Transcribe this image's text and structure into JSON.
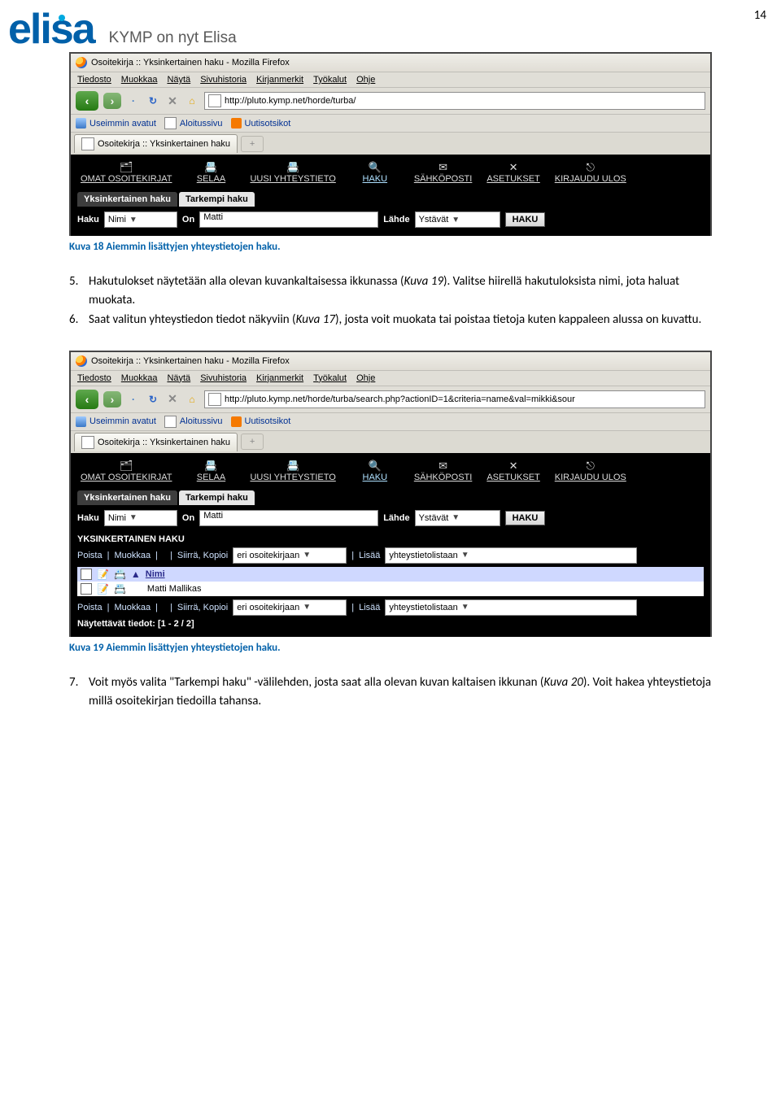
{
  "page_number": "14",
  "logo_text": "elisa",
  "logo_sub": "KYMP on nyt Elisa",
  "shot1": {
    "title": "Osoitekirja :: Yksinkertainen haku - Mozilla Firefox",
    "menu": {
      "t": "Tiedosto",
      "m": "Muokkaa",
      "n": "Näytä",
      "s": "Sivuhistoria",
      "k": "Kirjanmerkit",
      "ty": "Työkalut",
      "o": "Ohje"
    },
    "url": "http://pluto.kymp.net/horde/turba/",
    "bm": {
      "a": "Useimmin avatut",
      "b": "Aloitussivu",
      "c": "Uutisotsikot"
    },
    "tab": "Osoitekirja :: Yksinkertainen haku",
    "topmenu": {
      "omat": "OMAT OSOITEKIRJAT",
      "selaa": "SELAA",
      "uusi": "UUSI YHTEYSTIETO",
      "haku": "HAKU",
      "sahko": "SÄHKÖPOSTI",
      "aset": "ASETUKSET",
      "kirj": "KIRJAUDU ULOS"
    },
    "subtabs": {
      "a": "Yksinkertainen haku",
      "b": "Tarkempi haku"
    },
    "labels": {
      "haku": "Haku",
      "on": "On",
      "lahde": "Lähde",
      "btn": "HAKU"
    },
    "field": "Nimi",
    "value": "Matti",
    "source": "Ystävät"
  },
  "cap1": "Kuva 18 Aiemmin lisättyjen yhteystietojen haku.",
  "para_5": {
    "n": "5.",
    "a": "Hakutulokset näytetään alla olevan kuvankaltaisessa ikkunassa (",
    "i": "Kuva 19",
    "b": "). Valitse hiirellä hakutuloksista nimi, jota haluat muokata."
  },
  "para_6": {
    "n": "6.",
    "a": "Saat valitun yhteystiedon tiedot näkyviin (",
    "i": "Kuva 17",
    "b": "), josta voit muokata tai poistaa tietoja kuten kappaleen alussa on kuvattu."
  },
  "shot2": {
    "title": "Osoitekirja :: Yksinkertainen haku - Mozilla Firefox",
    "url": "http://pluto.kymp.net/horde/turba/search.php?actionID=1&criteria=name&val=mikki&sour",
    "reshdr": "YKSINKERTAINEN HAKU",
    "tb": {
      "poista": "Poista",
      "muokkaa": "Muokkaa",
      "sep": "|",
      "siirra": "Siirrä, Kopioi",
      "siirraopt": "eri osoitekirjaan",
      "lisaa": "Lisää",
      "lisaaopt": "yhteystietolistaan"
    },
    "col": "Nimi",
    "row": "Matti Mallikas",
    "foot": "Näytettävät tiedot: [1 - 2 / 2]"
  },
  "cap2": "Kuva 19 Aiemmin lisättyjen yhteystietojen haku.",
  "para_7": {
    "n": "7.",
    "a": "Voit myös valita \"Tarkempi haku\" -välilehden, josta saat alla olevan kuvan kaltaisen ikkunan (",
    "i": "Kuva 20",
    "b": "). Voit hakea yhteystietoja millä osoitekirjan tiedoilla tahansa."
  }
}
